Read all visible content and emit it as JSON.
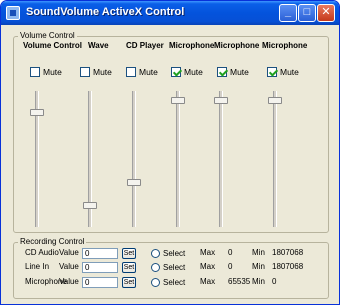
{
  "window": {
    "title": "SoundVolume ActiveX Control"
  },
  "titlebar_buttons": {
    "minimize": "_",
    "maximize": "□",
    "close": "✕"
  },
  "volume_group": {
    "label": "Volume Control",
    "mute_label": "Mute",
    "channels": [
      {
        "label": "Volume Control",
        "muted": false,
        "level": 0.9
      },
      {
        "label": "Wave",
        "muted": false,
        "level": 0.1
      },
      {
        "label": "CD Player",
        "muted": false,
        "level": 0.3
      },
      {
        "label": "Microphone",
        "muted": true,
        "level": 1.0
      },
      {
        "label": "Microphone",
        "muted": true,
        "level": 1.0
      },
      {
        "label": "Microphone",
        "muted": true,
        "level": 1.0
      }
    ]
  },
  "recording_group": {
    "label": "Recording Control",
    "value_label": "Value",
    "set_label": "Set",
    "select_label": "Select",
    "max_label": "Max",
    "min_label": "Min",
    "rows": [
      {
        "name": "CD Audio",
        "value": "0",
        "max": "0",
        "min": "1807068"
      },
      {
        "name": "Line In",
        "value": "0",
        "max": "0",
        "min": "1807068"
      },
      {
        "name": "Microphone",
        "value": "0",
        "max": "65535",
        "min": "0"
      }
    ]
  }
}
